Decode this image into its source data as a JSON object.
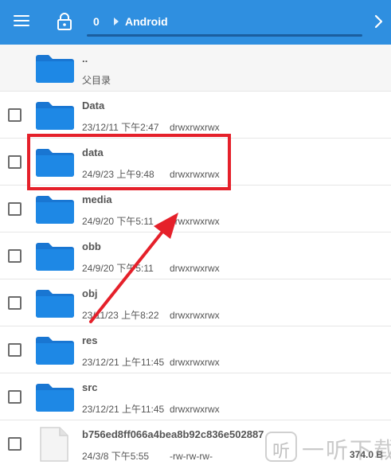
{
  "toolbar": {
    "breadcrumb": [
      "0",
      "Android"
    ],
    "accent_color": "#2f8fe0"
  },
  "files": [
    {
      "name": "..",
      "date": "父目录",
      "perm": "",
      "size": "",
      "type": "parent",
      "checkbox": false
    },
    {
      "name": "Data",
      "date": "23/12/11 下午2:47",
      "perm": "drwxrwxrwx",
      "size": "",
      "type": "folder",
      "checkbox": true
    },
    {
      "name": "data",
      "date": "24/9/23 上午9:48",
      "perm": "drwxrwxrwx",
      "size": "",
      "type": "folder",
      "checkbox": true
    },
    {
      "name": "media",
      "date": "24/9/20 下午5:11",
      "perm": "drwxrwxrwx",
      "size": "",
      "type": "folder",
      "checkbox": true
    },
    {
      "name": "obb",
      "date": "24/9/20 下午5:11",
      "perm": "drwxrwxrwx",
      "size": "",
      "type": "folder",
      "checkbox": true
    },
    {
      "name": "obj",
      "date": "23/11/23 上午8:22",
      "perm": "drwxrwxrwx",
      "size": "",
      "type": "folder",
      "checkbox": true
    },
    {
      "name": "res",
      "date": "23/12/21 上午11:45",
      "perm": "drwxrwxrwx",
      "size": "",
      "type": "folder",
      "checkbox": true
    },
    {
      "name": "src",
      "date": "23/12/21 上午11:45",
      "perm": "drwxrwxrwx",
      "size": "",
      "type": "folder",
      "checkbox": true
    },
    {
      "name": "b756ed8ff066a4bea8b92c836e502887",
      "date": "24/3/8 下午5:55",
      "perm": "-rw-rw-rw-",
      "size": "374.0 B",
      "type": "file",
      "checkbox": true
    }
  ],
  "annotation": {
    "highlight_color": "#e5202a"
  },
  "watermark": {
    "logo": "听",
    "text": "一听下载"
  }
}
